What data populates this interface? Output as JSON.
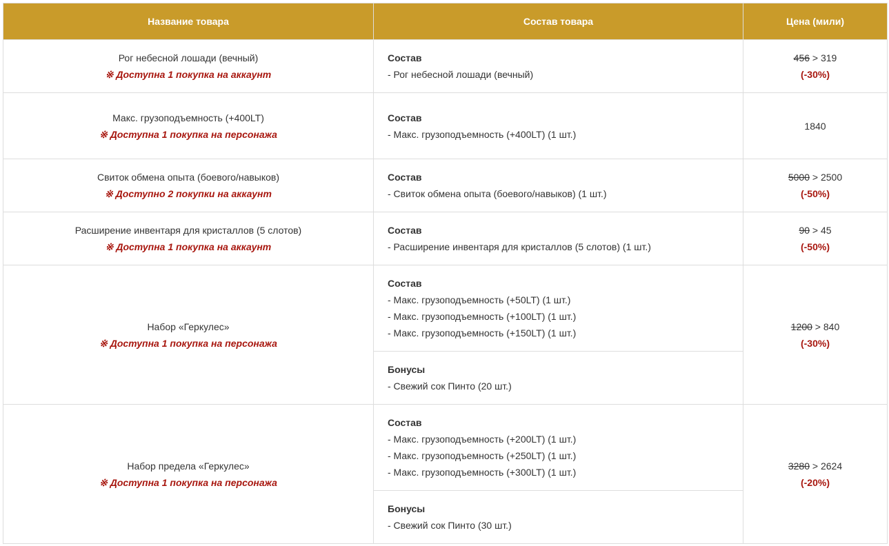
{
  "header": {
    "col_name": "Название товара",
    "col_composition": "Состав товара",
    "col_price": "Цена (мили)"
  },
  "limit_mark": "※",
  "price_sep": ">",
  "rows": [
    {
      "name": "Рог небесной лошади (вечный)",
      "limit": "Доступна 1 покупка на аккаунт",
      "composition": {
        "title": "Состав",
        "items": [
          "- Рог небесной лошади (вечный)"
        ]
      },
      "price": {
        "old": "456",
        "new": "319",
        "discount": "(-30%)"
      }
    },
    {
      "name": "Макс. грузоподъемность (+400LT)",
      "limit": "Доступна 1 покупка на персонажа",
      "composition": {
        "title": "Состав",
        "items": [
          "- Макс. грузоподъемность (+400LT) (1 шт.)"
        ]
      },
      "price": {
        "single": "1840"
      }
    },
    {
      "name": "Свиток обмена опыта (боевого/навыков)",
      "limit": "Доступно 2 покупки на аккаунт",
      "composition": {
        "title": "Состав",
        "items": [
          "- Свиток обмена опыта (боевого/навыков) (1 шт.)"
        ]
      },
      "price": {
        "old": "5000",
        "new": "2500",
        "discount": "(-50%)"
      }
    },
    {
      "name": "Расширение инвентаря для кристаллов (5 слотов)",
      "limit": "Доступна 1 покупка на аккаунт",
      "composition": {
        "title": "Состав",
        "items": [
          "- Расширение инвентаря для кристаллов (5 слотов) (1 шт.)"
        ]
      },
      "price": {
        "old": "90",
        "new": "45",
        "discount": "(-50%)"
      }
    },
    {
      "name": "Набор «Геркулес»",
      "limit": "Доступна 1 покупка на персонажа",
      "composition": {
        "title": "Состав",
        "items": [
          "- Макс. грузоподъемность (+50LT) (1 шт.)",
          "- Макс. грузоподъемность (+100LT) (1 шт.)",
          "- Макс. грузоподъемность (+150LT) (1 шт.)"
        ]
      },
      "bonus": {
        "title": "Бонусы",
        "items": [
          "- Свежий сок Пинто (20 шт.)"
        ]
      },
      "price": {
        "old": "1200",
        "new": "840",
        "discount": "(-30%)"
      }
    },
    {
      "name": "Набор предела «Геркулес»",
      "limit": "Доступна 1 покупка на персонажа",
      "composition": {
        "title": "Состав",
        "items": [
          "- Макс. грузоподъемность (+200LT) (1 шт.)",
          "- Макс. грузоподъемность (+250LT) (1 шт.)",
          "- Макс. грузоподъемность (+300LT) (1 шт.)"
        ]
      },
      "bonus": {
        "title": "Бонусы",
        "items": [
          "- Свежий сок Пинто (30 шт.)"
        ]
      },
      "price": {
        "old": "3280",
        "new": "2624",
        "discount": "(-20%)"
      }
    }
  ]
}
